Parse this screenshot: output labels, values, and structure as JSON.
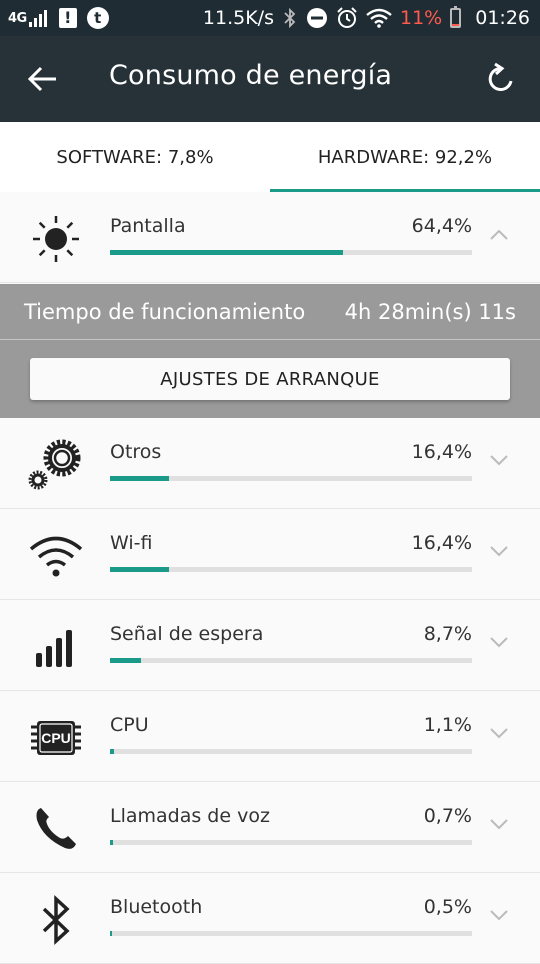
{
  "status_bar": {
    "network": "4G",
    "speed": "11.5K/s",
    "battery_percent": "11%",
    "battery_level": 0.11,
    "time": "01:26",
    "left_icons": [
      "signal-icon",
      "alert-icon",
      "t-app-icon"
    ],
    "right_icons": [
      "bluetooth-icon",
      "dnd-icon",
      "alarm-icon",
      "wifi-icon",
      "battery-icon"
    ]
  },
  "app_bar": {
    "title": "Consumo de energía",
    "back_icon": "arrow-left-icon",
    "refresh_icon": "refresh-icon"
  },
  "tabs": [
    {
      "label": "SOFTWARE: 7,8%",
      "active": false
    },
    {
      "label": "HARDWARE: 92,2%",
      "active": true
    }
  ],
  "expanded": {
    "label": "Pantalla",
    "percent": "64,4%",
    "value": 64.4,
    "icon": "sun-icon",
    "uptime_label": "Tiempo de funcionamiento",
    "uptime_value": "4h 28min(s) 11s",
    "button_label": "AJUSTES DE ARRANQUE"
  },
  "items": [
    {
      "label": "Otros",
      "percent": "16,4%",
      "value": 16.4,
      "icon": "gears-icon"
    },
    {
      "label": "Wi-fi",
      "percent": "16,4%",
      "value": 16.4,
      "icon": "wifi-icon"
    },
    {
      "label": "Señal de espera",
      "percent": "8,7%",
      "value": 8.7,
      "icon": "signal-bars-icon"
    },
    {
      "label": "CPU",
      "percent": "1,1%",
      "value": 1.1,
      "icon": "cpu-icon",
      "icon_text": "CPU"
    },
    {
      "label": "Llamadas de voz",
      "percent": "0,7%",
      "value": 0.7,
      "icon": "phone-icon"
    },
    {
      "label": "Bluetooth",
      "percent": "0,5%",
      "value": 0.5,
      "icon": "bluetooth-icon"
    }
  ],
  "colors": {
    "accent": "#1a9b8a",
    "app_bar": "#263238",
    "status_bar": "#1f2c33",
    "battery_low": "#ff5a4e"
  }
}
